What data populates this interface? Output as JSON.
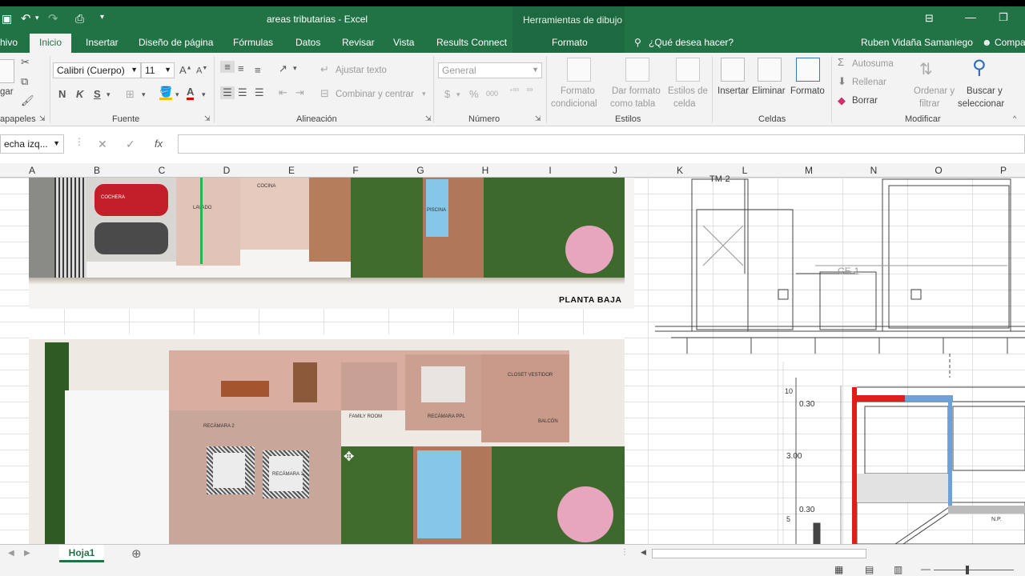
{
  "window": {
    "title": "areas tributarias - Excel",
    "context_tool": "Herramientas de dibujo"
  },
  "tabs": [
    "hivo",
    "Inicio",
    "Insertar",
    "Diseño de página",
    "Fórmulas",
    "Datos",
    "Revisar",
    "Vista",
    "Results Connect",
    "Formato"
  ],
  "tellme": "¿Qué desea hacer?",
  "user": "Ruben Vidaña Samaniego",
  "share": "Compa",
  "ribbon": {
    "clipboard": {
      "paste": "gar",
      "label": "apapeles"
    },
    "font": {
      "name": "Calibri (Cuerpo)",
      "size": "11",
      "bold": "N",
      "italic": "K",
      "underline": "S",
      "label": "Fuente"
    },
    "alignment": {
      "wrap": "Ajustar texto",
      "merge": "Combinar y centrar",
      "label": "Alineación"
    },
    "number": {
      "format": "General",
      "label": "Número"
    },
    "styles": {
      "cond": [
        "Formato",
        "condicional"
      ],
      "table": [
        "Dar formato",
        "como tabla"
      ],
      "cell": [
        "Estilos de",
        "celda"
      ],
      "label": "Estilos"
    },
    "cells": {
      "insert": "Insertar",
      "delete": "Eliminar",
      "format": "Formato",
      "label": "Celdas"
    },
    "editing": {
      "autosum": "Autosuma",
      "fill": "Rellenar",
      "clear": "Borrar",
      "sort": [
        "Ordenar y",
        "filtrar"
      ],
      "find": [
        "Buscar y",
        "seleccionar"
      ],
      "label": "Modificar"
    }
  },
  "namebox": "echa izq...",
  "fx": "fx",
  "columns": [
    "A",
    "B",
    "C",
    "D",
    "E",
    "F",
    "G",
    "H",
    "I",
    "J",
    "K",
    "L",
    "M",
    "N",
    "O",
    "P"
  ],
  "plan": {
    "label_ground": "PLANTA BAJA",
    "rooms_ground": {
      "garage": "COCHERA",
      "laundry": "LAVADO",
      "kitchen": "COCINA",
      "pool": "PISCINA"
    },
    "rooms_upper": {
      "closet": "CLOSET VESTIDOR",
      "family": "FAMILY ROOM",
      "master": "RECÁMARA PPL",
      "balcony": "BALCÓN",
      "bed2": "RECÁMARA 2",
      "bed1": "RECÁMARA 1"
    }
  },
  "cad": {
    "labels": [
      "TM-2",
      "CE-1"
    ],
    "dims": [
      "0.30",
      "3.00",
      "0.30"
    ],
    "tick1": "10",
    "tick2": "5",
    "npt": "N.P."
  },
  "sheet": {
    "tab": "Hoja1"
  }
}
